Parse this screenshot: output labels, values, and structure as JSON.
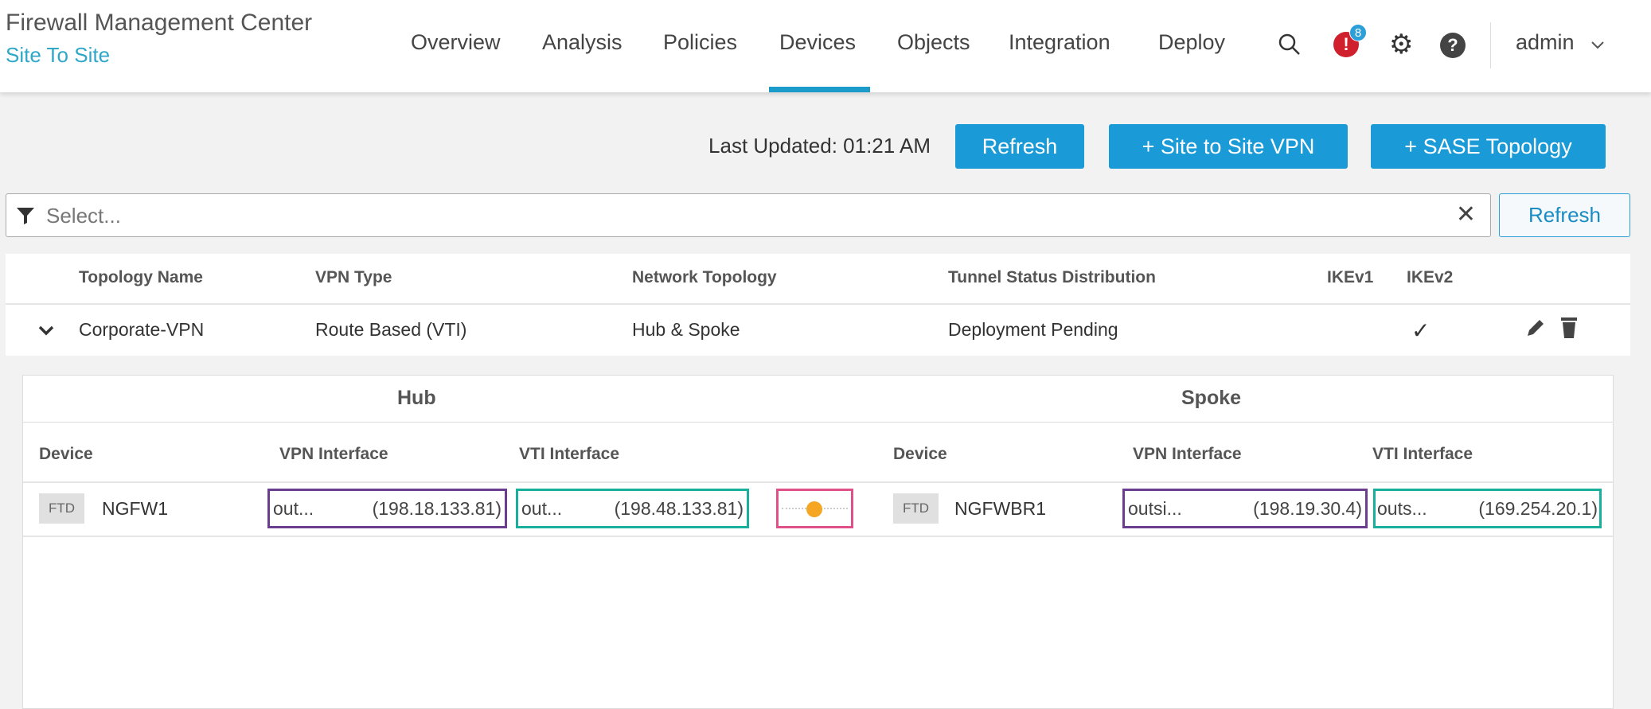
{
  "header": {
    "title": "Firewall Management Center",
    "subtitle": "Site To Site",
    "nav": [
      "Overview",
      "Analysis",
      "Policies",
      "Devices",
      "Objects",
      "Integration",
      "Deploy"
    ],
    "active_nav": "Devices",
    "alert_count": "8",
    "user": "admin"
  },
  "toolbar": {
    "last_updated": "Last Updated: 01:21 AM",
    "refresh_label": "Refresh",
    "site_to_site_label": "+ Site to Site VPN",
    "sase_label": "+ SASE Topology"
  },
  "filter": {
    "placeholder": "Select...",
    "refresh_label": "Refresh"
  },
  "table": {
    "headers": [
      "Topology Name",
      "VPN Type",
      "Network Topology",
      "Tunnel Status Distribution",
      "IKEv1",
      "IKEv2"
    ],
    "rows": [
      {
        "name": "Corporate-VPN",
        "vpn_type": "Route Based (VTI)",
        "network_topology": "Hub & Spoke",
        "tunnel_status": "Deployment Pending",
        "ikev1": "",
        "ikev2": "✓"
      }
    ]
  },
  "detail": {
    "hub_label": "Hub",
    "spoke_label": "Spoke",
    "headers": [
      "Device",
      "VPN Interface",
      "VTI Interface",
      "Device",
      "VPN Interface",
      "VTI Interface"
    ],
    "hub": {
      "badge": "FTD",
      "device": "NGFW1",
      "vpn_if": "out...",
      "vpn_ip": "(198.18.133.81)",
      "vti_if": "out...",
      "vti_ip": "(198.48.133.81)"
    },
    "spoke": {
      "badge": "FTD",
      "device": "NGFWBR1",
      "vpn_if": "outsi...",
      "vpn_ip": "(198.19.30.4)",
      "vti_if": "outs...",
      "vti_ip": "(169.254.20.1)"
    },
    "tunnel_status_color": "#f5a623"
  }
}
